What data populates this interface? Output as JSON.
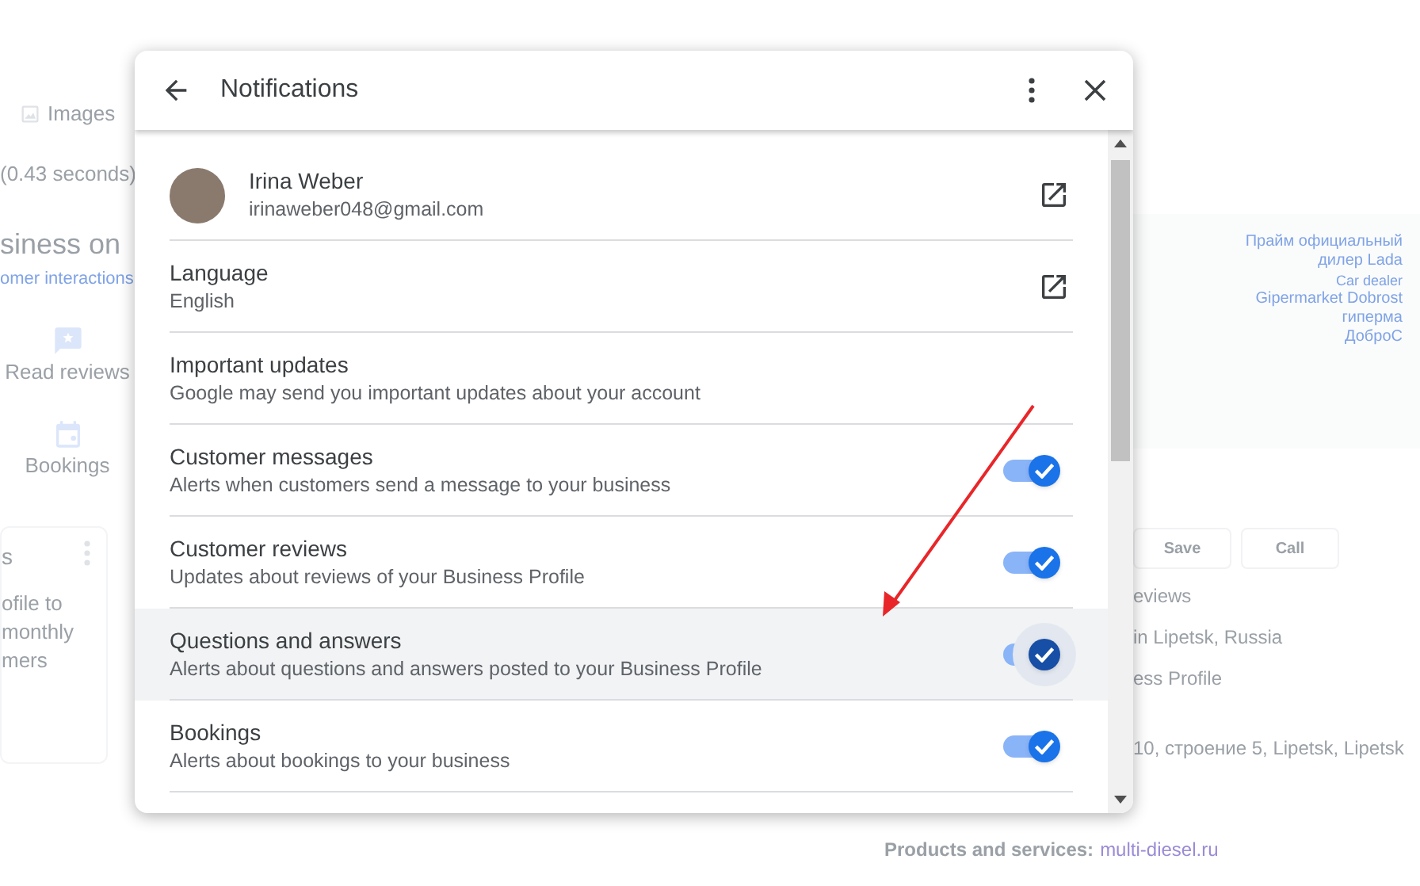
{
  "background": {
    "left": {
      "tab": "Images",
      "stats": "(0.43 seconds)",
      "heading": "siness on",
      "subheading": "omer interactions",
      "actions": [
        {
          "label": "Read reviews",
          "kind": "reviews"
        },
        {
          "label": "Bookings",
          "kind": "bookings"
        }
      ],
      "card_title": "s",
      "card_lines": [
        "ofile to",
        "monthly",
        "mers"
      ]
    },
    "right": {
      "map_labels": [
        "Прайм официальный",
        "дилер Lada",
        "Car dealer",
        "Gipermarket Dobrost",
        "гиперма",
        "ДоброС"
      ],
      "buttons": [
        "Save",
        "Call"
      ],
      "lines": [
        "eviews",
        "in Lipetsk, Russia",
        "ess Profile"
      ],
      "address": "10, строение 5, Lipetsk, Lipetsk"
    },
    "products": {
      "label": "Products and services:",
      "link": "multi-diesel.ru"
    }
  },
  "dialog": {
    "title": "Notifications",
    "rows": [
      {
        "kind": "profile",
        "title": "Irina Weber",
        "subtitle": "irinaweber048@gmail.com"
      },
      {
        "kind": "link",
        "title": "Language",
        "subtitle": "English"
      },
      {
        "kind": "text",
        "title": "Important updates",
        "subtitle": "Google may send you important updates about your account"
      },
      {
        "kind": "toggle",
        "title": "Customer messages",
        "subtitle": "Alerts when customers send a message to your business",
        "on": true,
        "highlighted": false
      },
      {
        "kind": "toggle",
        "title": "Customer reviews",
        "subtitle": "Updates about reviews of your Business Profile",
        "on": true,
        "highlighted": false
      },
      {
        "kind": "toggle",
        "title": "Questions and answers",
        "subtitle": "Alerts about questions and answers posted to your Business Profile",
        "on": true,
        "highlighted": true
      },
      {
        "kind": "toggle",
        "title": "Bookings",
        "subtitle": "Alerts about bookings to your business",
        "on": true,
        "highlighted": false
      }
    ]
  }
}
